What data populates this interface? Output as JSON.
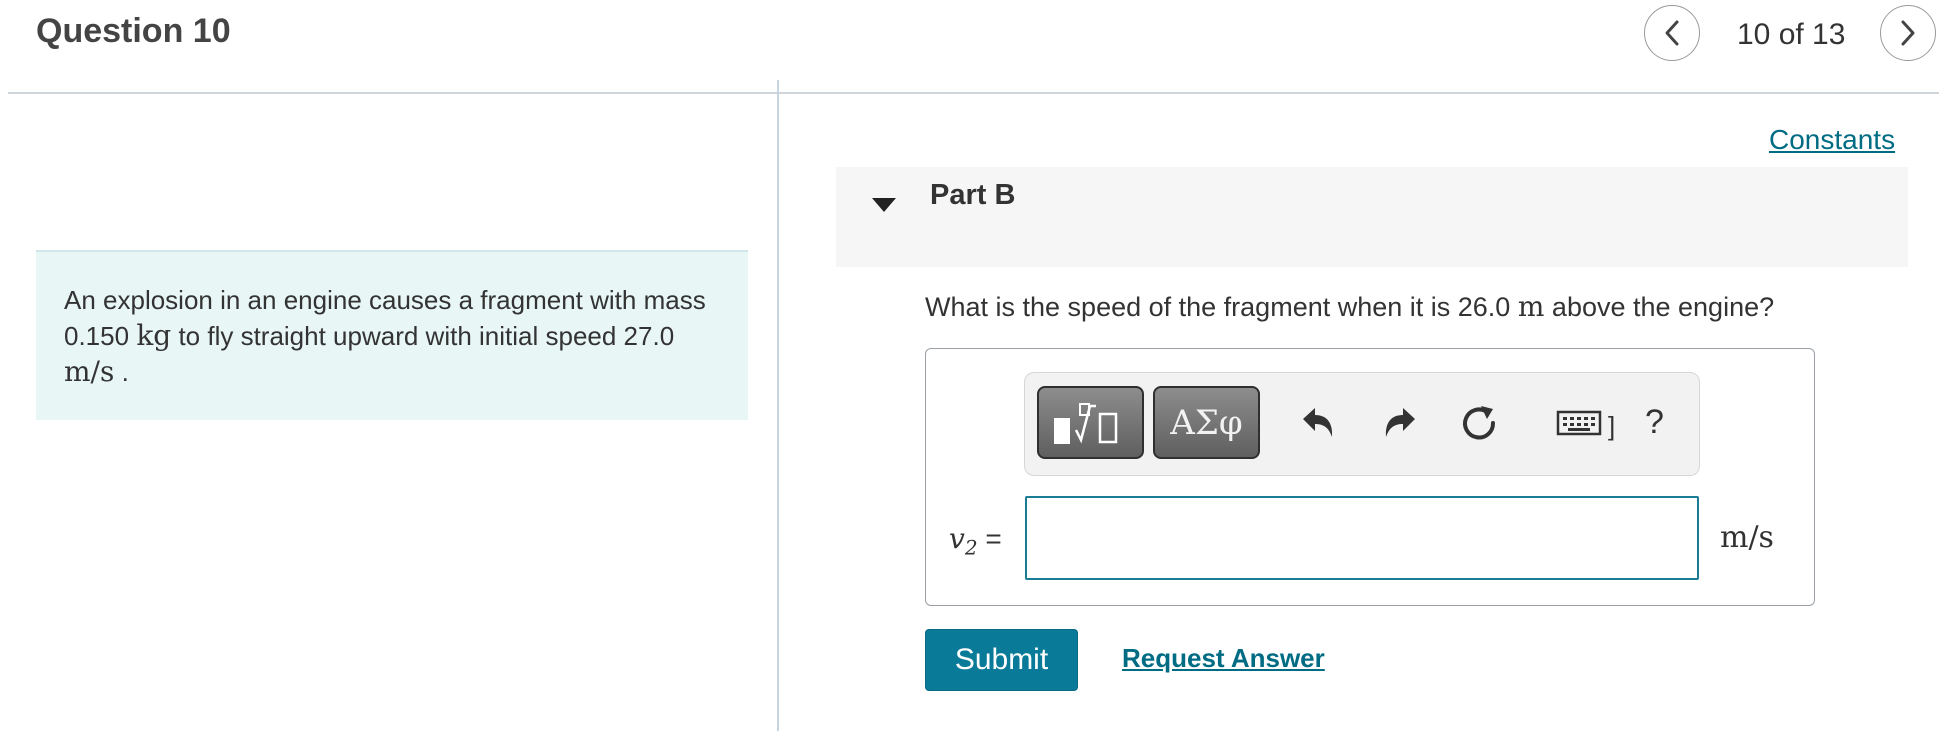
{
  "header": {
    "title": "Question 10",
    "counter": "10 of 13",
    "prev_icon": "chevron-left-icon",
    "next_icon": "chevron-right-icon"
  },
  "context": {
    "text_1": "An explosion in an engine causes a fragment with mass 0.150",
    "unit_mass": "kg",
    "text_2": "to fly straight upward with initial speed 27.0",
    "unit_speed": "m/s",
    "text_3": "."
  },
  "constants_link": "Constants",
  "part": {
    "title": "Part B",
    "toggle_icon": "triangle-down-icon"
  },
  "question": {
    "text_1": "What is the speed of the fragment when it is 26.0",
    "unit": "m",
    "text_2": "above the engine?"
  },
  "toolbar": {
    "symbols_label": "ΑΣφ",
    "bracket": "]",
    "help": "?",
    "icons": [
      "templates-icon",
      "greek-symbols-icon",
      "undo-icon",
      "redo-icon",
      "reset-icon",
      "keyboard-icon",
      "help-icon"
    ]
  },
  "answer": {
    "variable": "v",
    "subscript": "2",
    "equals": "=",
    "value": "",
    "placeholder": "",
    "units": "m/s"
  },
  "actions": {
    "submit_label": "Submit",
    "request_answer_label": "Request Answer"
  },
  "colors": {
    "accent": "#0a7a99",
    "link": "#006c84",
    "context_bg": "#e8f6f6"
  }
}
